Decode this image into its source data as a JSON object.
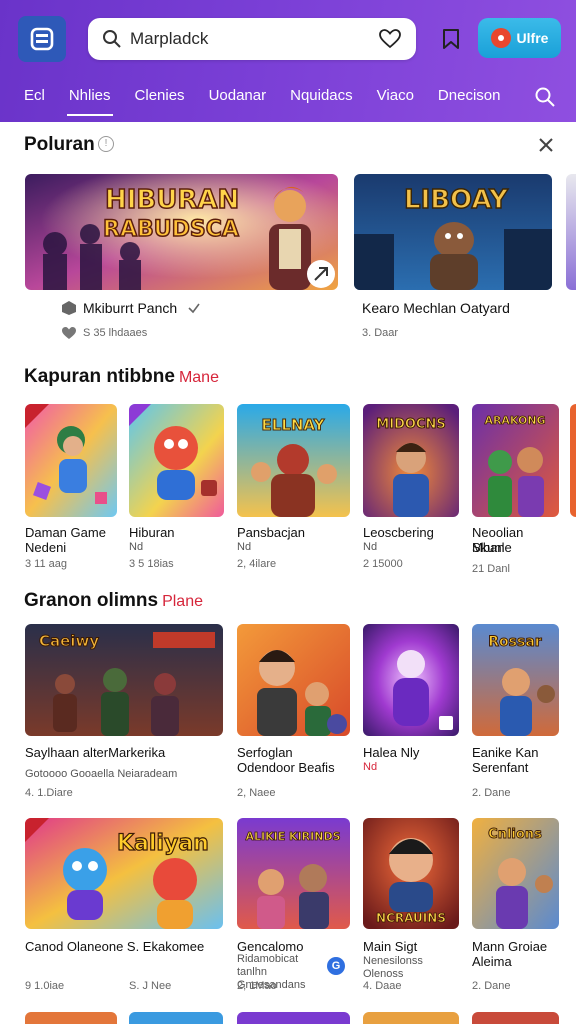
{
  "header": {
    "search_text": "Marpladck",
    "promo_label": "Ulfre",
    "nav": [
      "Ecl",
      "Nhlies",
      "Clenies",
      "Uodanar",
      "Nquidacs",
      "Viaco",
      "Dnecison"
    ]
  },
  "section1": {
    "title": "Poluran",
    "info": "!",
    "cards": [
      {
        "overlay": "HIBURAN RABUDSCA",
        "title": "Mkiburrt Panch",
        "meta": "S 35 lhdaaes"
      },
      {
        "overlay": "LIBOAY",
        "title": "Kearo Mechlan Oatyard",
        "meta": "3. Daar"
      }
    ]
  },
  "section2": {
    "title": "Kapuran ntibbne",
    "tag": "Mane",
    "cards": [
      {
        "title": "Daman Game",
        "sub": "Nedeni",
        "meta": "3 11 aag",
        "overlay": ""
      },
      {
        "title": "Hiburan",
        "sub": "Nd",
        "meta": "3 5 18ias",
        "overlay": ""
      },
      {
        "title": "Pansbacjan",
        "sub": "Nd",
        "meta": "2, 4ilare",
        "overlay": "ELLNAY"
      },
      {
        "title": "Leoscbering",
        "sub": "Nd",
        "meta": "2 15000",
        "overlay": "MIDOCNS"
      },
      {
        "title": "Neoolian Mban",
        "sub": "Skunle",
        "meta": "21 Danl",
        "overlay": "ARAKONG"
      }
    ]
  },
  "section3": {
    "title": "Granon olimns",
    "tag": "Plane",
    "cards": [
      {
        "title": "Saylhaan alterMarkerika",
        "sub": "Gotoooo Gooaella Neiaradeam",
        "meta": "4. 1.Diare",
        "overlay": "Caeiwy"
      },
      {
        "title": "Serfoglan",
        "sub": "Odendoor Beafis",
        "meta": "2, Naee",
        "overlay": ""
      },
      {
        "title": "Halea Nly",
        "sub": "Nd",
        "meta": "",
        "overlay": ""
      },
      {
        "title": "Eanike Kan",
        "sub": "Serenfant",
        "meta": "2. Dane",
        "overlay": "Rossar"
      }
    ]
  },
  "section4": {
    "cards": [
      {
        "title": "Canod Olaneone S. Ekakomee",
        "sub": "",
        "meta": "9 1.0iae",
        "meta2": "S. J Nee",
        "overlay": "Kaliyan"
      },
      {
        "title": "Gencalomo",
        "sub": "Ridamobicat tanlhn Gneesandans",
        "meta": "2, 1Mao",
        "overlay": "ALIKIE KIRINDS"
      },
      {
        "title": "Main Sigt",
        "sub": "Nenesilonss Olenoss",
        "meta": "4. Daae",
        "overlay": "NCRAUINS"
      },
      {
        "title": "Mann Groiae Aleima",
        "sub": "",
        "meta": "2. Dane",
        "overlay": "Cnlions"
      }
    ]
  }
}
